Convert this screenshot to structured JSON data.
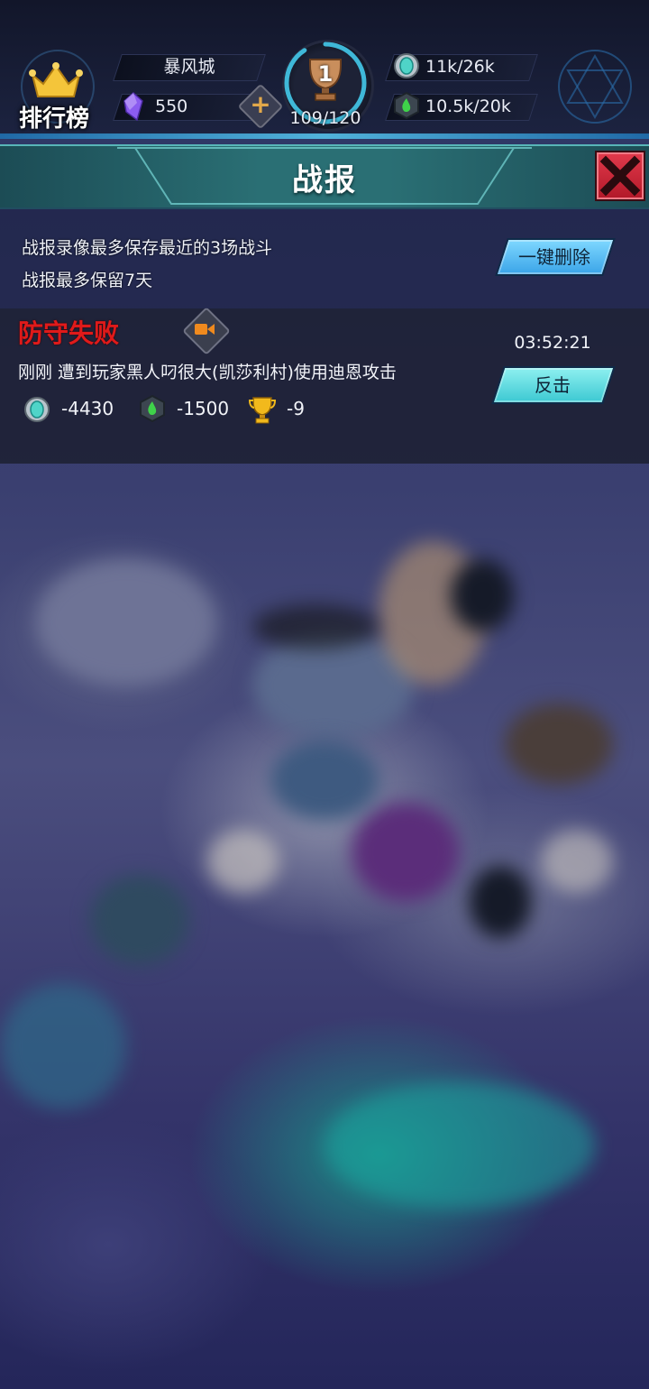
{
  "topbar": {
    "rank_label": "排行榜",
    "city_name": "暴风城",
    "gems": "550",
    "trophy_level": "1",
    "trophy_progress": "109/120",
    "trophy_fill": 0.908,
    "resource_1": "11k/26k",
    "resource_2": "10.5k/20k"
  },
  "panel": {
    "title": "战报",
    "info_line_1": "战报录像最多保存最近的3场战斗",
    "info_line_2": "战报最多保留7天",
    "delete_all_label": "一键删除"
  },
  "record": {
    "result": "防守失败",
    "time": "03:52:21",
    "description": "刚刚 遭到玩家黑人叼很大(凯莎利村)使用迪恩攻击",
    "counterattack_label": "反击",
    "loss_resource_1": "-4430",
    "loss_resource_2": "-1500",
    "loss_trophies": "-9"
  },
  "colors": {
    "accent_cyan": "#3fd0e8",
    "defeat_red": "#e01a1a",
    "header_teal": "#2a6f74",
    "close_red": "#c8202f"
  },
  "icons": [
    "crown-icon",
    "gem-icon",
    "plus-icon",
    "trophy-icon",
    "crystal-resource-icon",
    "elixir-resource-icon",
    "close-icon",
    "video-icon",
    "gold-trophy-icon"
  ]
}
